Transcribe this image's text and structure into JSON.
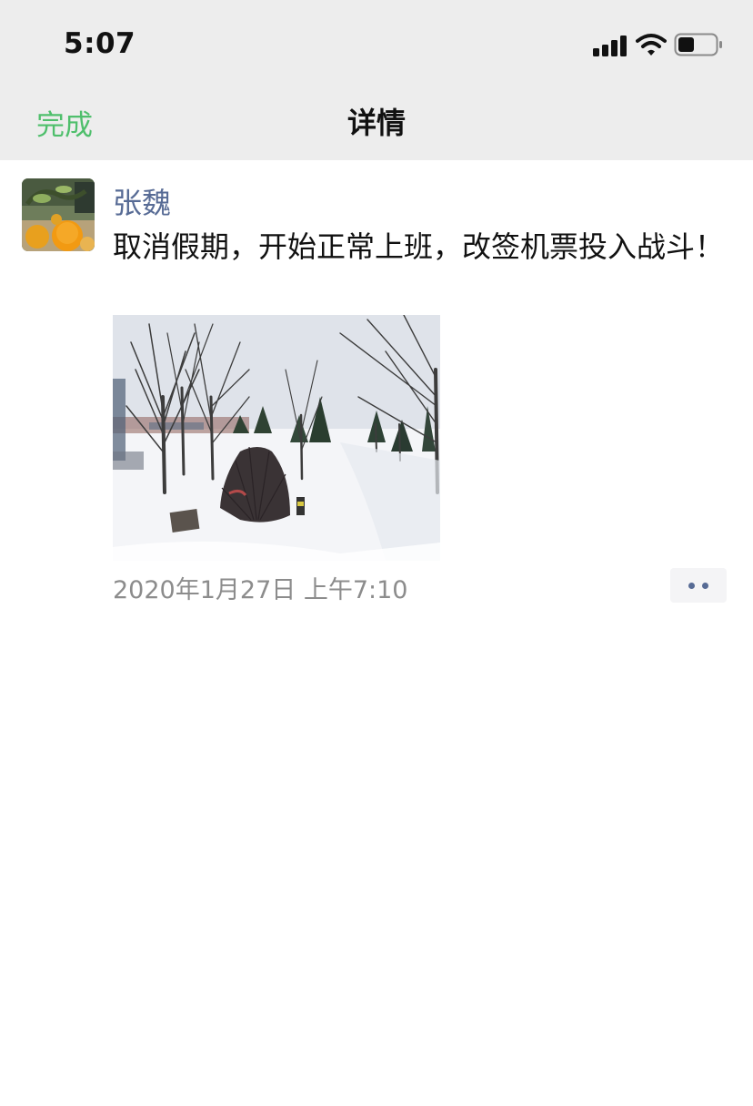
{
  "status_bar": {
    "time": "5:07",
    "icons": [
      "signal-icon",
      "wifi-icon",
      "battery-icon"
    ]
  },
  "nav": {
    "done_label": "完成",
    "title": "详情"
  },
  "post": {
    "author": "张魏",
    "text": "取消假期，开始正常上班，改签机票投入战斗！",
    "timestamp": "2020年1月27日 上午7:10",
    "more_icon": "more-dots-icon"
  },
  "colors": {
    "accent_green": "#4fbf6c",
    "author_blue": "#576b95",
    "nav_background": "#ededed",
    "timestamp_gray": "#8c8c8c"
  }
}
